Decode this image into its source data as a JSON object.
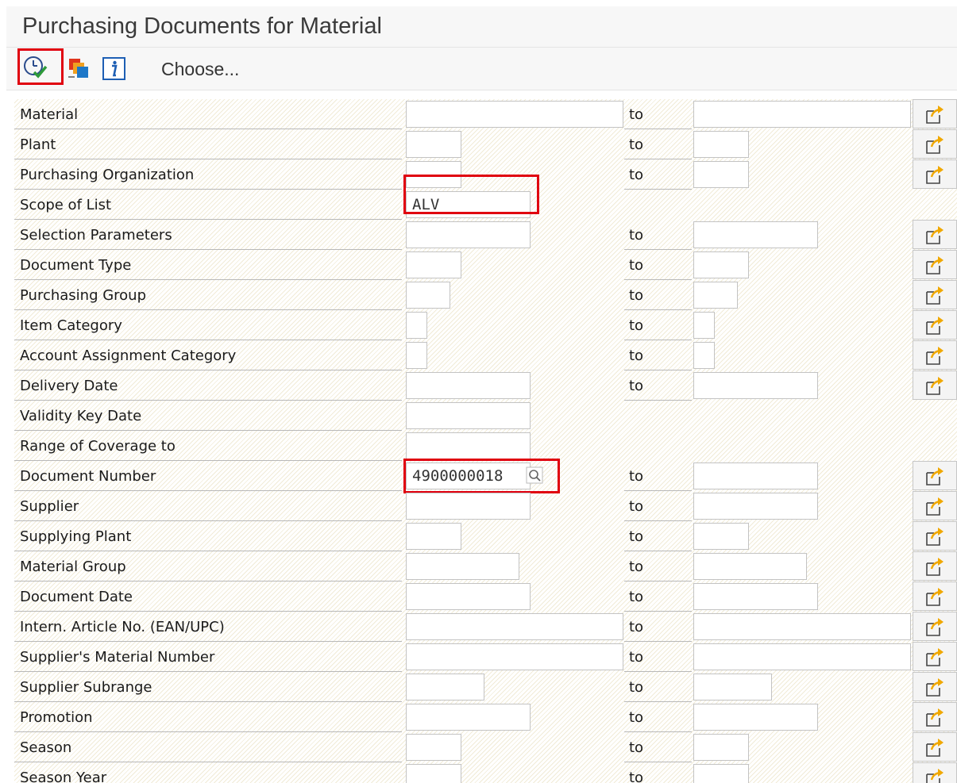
{
  "window": {
    "title": "Purchasing Documents for Material"
  },
  "toolbar": {
    "execute_icon": "execute-clock-check-icon",
    "overlay_icon": "overlapping-windows-icon",
    "info_icon": "info-icon",
    "choose_label": "Choose..."
  },
  "to_label": "to",
  "multiple_selection_icon": "multiple-selection-arrow-icon",
  "value_help_icon": "value-help-icon",
  "highlight_color": "#e0000f",
  "fields": [
    {
      "label": "Material",
      "low_value": "",
      "has_to": true,
      "high_value": ""
    },
    {
      "label": "Plant",
      "low_value": "",
      "has_to": true,
      "high_value": ""
    },
    {
      "label": "Purchasing Organization",
      "low_value": "",
      "has_to": true,
      "high_value": ""
    },
    {
      "label": "Scope of List",
      "low_value": "ALV",
      "has_to": false
    },
    {
      "label": "Selection Parameters",
      "low_value": "",
      "has_to": true,
      "high_value": ""
    },
    {
      "label": "Document Type",
      "low_value": "",
      "has_to": true,
      "high_value": ""
    },
    {
      "label": "Purchasing Group",
      "low_value": "",
      "has_to": true,
      "high_value": ""
    },
    {
      "label": "Item Category",
      "low_value": "",
      "has_to": true,
      "high_value": ""
    },
    {
      "label": "Account Assignment Category",
      "low_value": "",
      "has_to": true,
      "high_value": ""
    },
    {
      "label": "Delivery Date",
      "low_value": "",
      "has_to": true,
      "high_value": ""
    },
    {
      "label": "Validity Key Date",
      "low_value": "",
      "has_to": false
    },
    {
      "label": "Range of Coverage to",
      "low_value": "",
      "has_to": false
    },
    {
      "label": "Document Number",
      "low_value": "4900000018",
      "has_to": true,
      "high_value": ""
    },
    {
      "label": "Supplier",
      "low_value": "",
      "has_to": true,
      "high_value": ""
    },
    {
      "label": "Supplying Plant",
      "low_value": "",
      "has_to": true,
      "high_value": ""
    },
    {
      "label": "Material Group",
      "low_value": "",
      "has_to": true,
      "high_value": ""
    },
    {
      "label": "Document Date",
      "low_value": "",
      "has_to": true,
      "high_value": ""
    },
    {
      "label": "Intern. Article No. (EAN/UPC)",
      "low_value": "",
      "has_to": true,
      "high_value": ""
    },
    {
      "label": "Supplier's Material Number",
      "low_value": "",
      "has_to": true,
      "high_value": ""
    },
    {
      "label": "Supplier Subrange",
      "low_value": "",
      "has_to": true,
      "high_value": ""
    },
    {
      "label": "Promotion",
      "low_value": "",
      "has_to": true,
      "high_value": ""
    },
    {
      "label": "Season",
      "low_value": "",
      "has_to": true,
      "high_value": ""
    },
    {
      "label": "Season Year",
      "low_value": "",
      "has_to": true,
      "high_value": ""
    }
  ]
}
